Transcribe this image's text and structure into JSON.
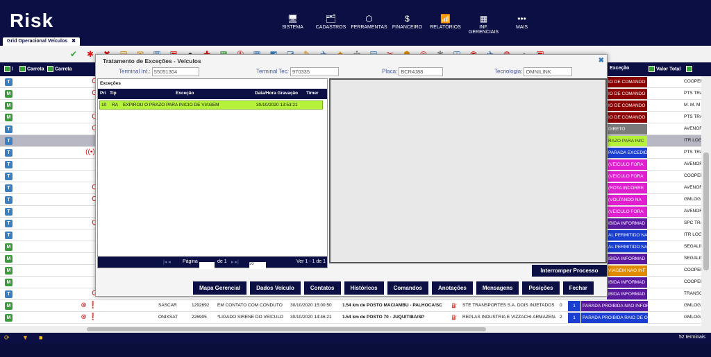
{
  "app": {
    "logo": "Risk"
  },
  "nav": [
    {
      "icon": "🖥",
      "label": "SISTEMA"
    },
    {
      "icon": "🗂",
      "label": "CADASTROS"
    },
    {
      "icon": "⬡",
      "label": "FERRAMENTAS"
    },
    {
      "icon": "$",
      "label": "FINANCEIRO"
    },
    {
      "icon": "📶",
      "label": "RELATÓRIOS"
    },
    {
      "icon": "▦",
      "label": "INF. GERENCIAIS"
    },
    {
      "icon": "•••",
      "label": "MAIS"
    }
  ],
  "tab": {
    "label": "Grid Operacional Veículos",
    "close": "✖"
  },
  "grid_header": {
    "col_carreta1": "Carreta",
    "col_carreta2": "Carreta",
    "col_excecao": "Exceção",
    "col_valor_total": "Valor Total",
    "col_v": "\\"
  },
  "rows": [
    {
      "tag": "T",
      "icons": "O",
      "exc": "IO DE COMANDO",
      "exc_color": "#8b0000",
      "company": "COOPER"
    },
    {
      "tag": "M",
      "icons": "O",
      "exc": "IO DE COMANDO",
      "exc_color": "#8b0000",
      "company": "PTS TRA"
    },
    {
      "tag": "M",
      "icons": "",
      "exc": "IO DE COMANDO",
      "exc_color": "#8b0000",
      "company": "M. M. M"
    },
    {
      "tag": "M",
      "icons": "O",
      "exc": "IO DE COMANDO",
      "exc_color": "#8b0000",
      "company": "PTS TRA"
    },
    {
      "tag": "T",
      "icons": "O",
      "exc": "DIRETO",
      "exc_color": "#7a7a7a",
      "company": "AVENOR"
    },
    {
      "tag": "T",
      "icons": "",
      "exc": "RAZO PARA INIC",
      "exc_color": "#b6f23a",
      "company": "ITR LOG"
    },
    {
      "tag": "T",
      "icons": "((•))",
      "exc": "PARADA EXCEDIDO",
      "exc_color": "#1a3fd0",
      "company": "PTS TRA"
    },
    {
      "tag": "T",
      "icons": "",
      "exc": "(VEICULO FORA",
      "exc_color": "#e020d0",
      "company": "AVENOR"
    },
    {
      "tag": "T",
      "icons": "",
      "exc": "(VEICULO FORA",
      "exc_color": "#e020d0",
      "company": "COOPER"
    },
    {
      "tag": "T",
      "icons": "O",
      "exc": "(ROTA INCORRE",
      "exc_color": "#e020d0",
      "company": "AVENOR"
    },
    {
      "tag": "T",
      "icons": "O",
      "exc": "(VOLTANDO NA",
      "exc_color": "#e020d0",
      "company": "GMLOG"
    },
    {
      "tag": "T",
      "icons": "",
      "exc": "(VEICULO FORA",
      "exc_color": "#e020d0",
      "company": "AVENOR"
    },
    {
      "tag": "T",
      "icons": "O",
      "exc": "IBIDA INFORMAD",
      "exc_color": "#5a1aa0",
      "company": "SPC TRA"
    },
    {
      "tag": "T",
      "icons": "",
      "exc": "AL PERMITIDO NA",
      "exc_color": "#1a3fd0",
      "company": "ITR LOG"
    },
    {
      "tag": "M",
      "icons": "",
      "exc": "AL PERMITIDO NA",
      "exc_color": "#1a3fd0",
      "company": "SEGALIN"
    },
    {
      "tag": "M",
      "icons": "",
      "exc": "IBIDA INFORMAD",
      "exc_color": "#5a1aa0",
      "company": "SEGALIN"
    },
    {
      "tag": "M",
      "icons": "",
      "exc": "VIAGEM NAO INF",
      "exc_color": "#e08a00",
      "company": "COOPER"
    },
    {
      "tag": "M",
      "icons": "",
      "exc": "IBIDA INFORMAD",
      "exc_color": "#5a1aa0",
      "company": "COOPER"
    },
    {
      "tag": "T",
      "icons": "O",
      "exc": "IBIDA INFORMAD",
      "exc_color": "#5a1aa0",
      "company": "TRANSC"
    }
  ],
  "bottom_rows": [
    {
      "tag": "M",
      "tech": "SASCAR",
      "terminal": "1292692",
      "msg": "EM CONTATO COM CONDUTO",
      "date": "30/10/2020 15:00:50",
      "loc": "1.54 km de POSTO MACIAMBU - PALHOCA/SC",
      "client": "STE TRANSPORTES S.A. DOIS INJETADOS LT",
      "count": "0",
      "num": "1",
      "exc": "PARADA PROIBIDA NAO INFOR",
      "company": "GMLOG"
    },
    {
      "tag": "M",
      "tech": "ONIXSAT",
      "terminal": "226905",
      "msg": "*LIGADO SIRENE DO VEÍCULO",
      "date": "30/10/2020 14:46:21",
      "loc": "1.54 km de POSTO 70 - JUQUITIBA/SP",
      "client": "REPLAS INDUSTRIA E VIZZACHI ARMAZENA",
      "count": "2",
      "num": "1",
      "exc": "PARADA PROIBIDA RAIO DE OF",
      "company": "GMLOG"
    }
  ],
  "footer": {
    "terminals": "52 terminais"
  },
  "modal": {
    "title": "Tratamento de Exceções - Veículos",
    "close": "✖",
    "terminal_int_label": "Terminal Int.:",
    "terminal_int_value": "55051304",
    "terminal_tec_label": "Terminal Tec:",
    "terminal_tec_value": "970335",
    "placa_label": "Placa:",
    "placa_value": "BCR4J88",
    "tecnologia_label": "Tecnologia:",
    "tecnologia_value": "OMNILINK",
    "exceptions_label": "Exceções",
    "exc_headers": {
      "pri": "Pri",
      "tip": "Tip",
      "excecao": "Exceção",
      "datahora": "Data/Hora Gravação",
      "timer": "Timer"
    },
    "exc_row": {
      "pri": "10",
      "tip": "RA",
      "excecao": "EXPIROU O PRAZO PARA INICIO DE VIAGEM",
      "datahora": "30/10/2020 13:53:21"
    },
    "pager": {
      "page_label": "Página",
      "of_label": "de 1",
      "per_page": "30",
      "range": "Ver 1 - 1 de 1"
    },
    "interromper": "Interromper Processo",
    "buttons": [
      "Mapa Gerencial",
      "Dados Veículo",
      "Contatos",
      "Históricos",
      "Comandos",
      "Anotações",
      "Mensagens",
      "Posições",
      "Fechar"
    ]
  }
}
